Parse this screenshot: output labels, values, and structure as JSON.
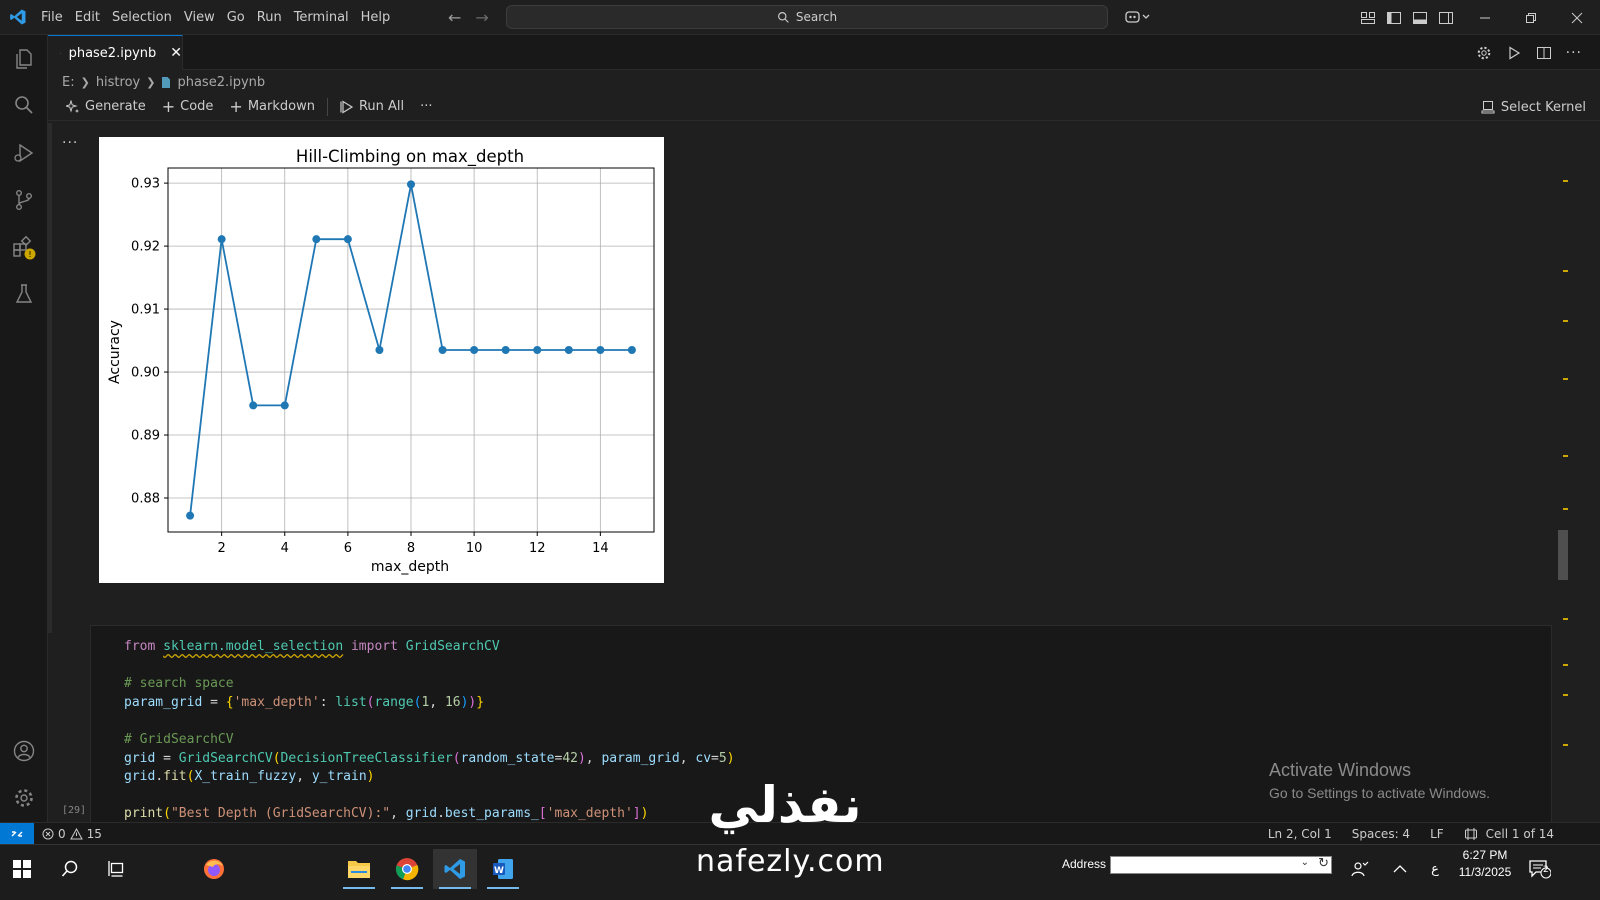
{
  "titlebar": {
    "menus": [
      "File",
      "Edit",
      "Selection",
      "View",
      "Go",
      "Run",
      "Terminal",
      "Help"
    ],
    "search_placeholder": "Search"
  },
  "tab": {
    "filename": "phase2.ipynb"
  },
  "breadcrumb": {
    "drive": "E:",
    "folder": "histroy",
    "file": "phase2.ipynb"
  },
  "notebook_toolbar": {
    "generate": "Generate",
    "code": "Code",
    "markdown": "Markdown",
    "run_all": "Run All",
    "more": "···",
    "select_kernel": "Select Kernel"
  },
  "output": {
    "menu": "···"
  },
  "chart_data": {
    "type": "line",
    "title": "Hill-Climbing on max_depth",
    "xlabel": "max_depth",
    "ylabel": "Accuracy",
    "x": [
      1,
      2,
      3,
      4,
      5,
      6,
      7,
      8,
      9,
      10,
      11,
      12,
      13,
      14,
      15
    ],
    "y": [
      0.8772,
      0.9211,
      0.8947,
      0.8947,
      0.9211,
      0.9211,
      0.9035,
      0.9298,
      0.9035,
      0.9035,
      0.9035,
      0.9035,
      0.9035,
      0.9035,
      0.9035
    ],
    "xticks": [
      2,
      4,
      6,
      8,
      10,
      12,
      14
    ],
    "yticks": [
      0.88,
      0.89,
      0.9,
      0.91,
      0.92,
      0.93
    ],
    "ytick_labels": [
      "0.88",
      "0.89",
      "0.90",
      "0.91",
      "0.92",
      "0.93"
    ],
    "xlim": [
      0.3,
      15.7
    ],
    "ylim": [
      0.8746,
      0.9324
    ],
    "grid": true,
    "marker": "circle",
    "color": "#1f77b4"
  },
  "code_cell": {
    "exec_count": "[29]",
    "lines": {
      "l1_from": "from",
      "l1_module": "sklearn.model_selection",
      "l1_import": "import",
      "l1_name": "GridSearchCV",
      "l2_comment": "# search space",
      "l3_var": "param_grid",
      "l3_eq": " = ",
      "l3_key": "'max_depth'",
      "l3_colon": ": ",
      "l3_list": "list",
      "l3_range": "range",
      "l3_n1": "1",
      "l3_comma": ", ",
      "l3_n2": "16",
      "l4_comment": "# GridSearchCV",
      "l5_var": "grid",
      "l5_eq": " = ",
      "l5_cls": "GridSearchCV",
      "l5_dtc": "DecisionTreeClassifier",
      "l5_rs": "random_state",
      "l5_eq2": "=",
      "l5_n42": "42",
      "l5_comma": ", ",
      "l5_pg": "param_grid",
      "l5_cv": "cv",
      "l5_n5": "5",
      "l6_grid": "grid",
      "l6_fit": "fit",
      "l6_x": "X_train_fuzzy",
      "l6_y": "y_train",
      "l7_print": "print",
      "l7_str": "\"Best Depth (GridSearchCV):\"",
      "l7_grid": "grid",
      "l7_bp": "best_params_",
      "l7_key": "'max_depth'"
    }
  },
  "activate_windows": {
    "title": "Activate Windows",
    "subtitle": "Go to Settings to activate Windows."
  },
  "watermark": {
    "arabic": "نفذلي",
    "latin": "nafezly.com"
  },
  "statusbar": {
    "errors": "0",
    "warnings": "15",
    "position": "Ln 2, Col 1",
    "spaces": "Spaces: 4",
    "eol": "LF",
    "cell": "Cell 1 of 14"
  },
  "taskbar": {
    "address_label": "Address",
    "lang": "ع",
    "time": "6:27 PM",
    "date": "11/3/2025",
    "notifications": "2"
  },
  "colors": {
    "accent": "#0078d4",
    "warning": "#cca700"
  }
}
